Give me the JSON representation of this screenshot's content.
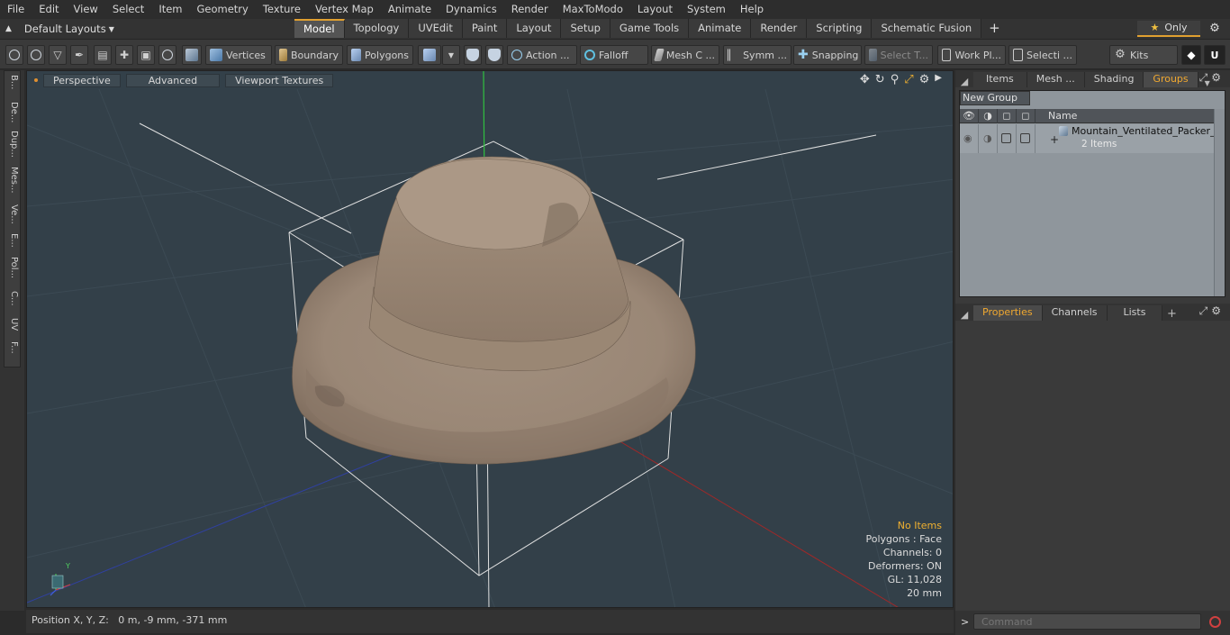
{
  "menu": [
    "File",
    "Edit",
    "View",
    "Select",
    "Item",
    "Geometry",
    "Texture",
    "Vertex Map",
    "Animate",
    "Dynamics",
    "Render",
    "MaxToModo",
    "Layout",
    "System",
    "Help"
  ],
  "layout_select": "Default Layouts",
  "tabs": [
    "Model",
    "Topology",
    "UVEdit",
    "Paint",
    "Layout",
    "Setup",
    "Game Tools",
    "Animate",
    "Render",
    "Scripting",
    "Schematic Fusion"
  ],
  "active_tab": "Model",
  "only_label": "Only",
  "toolbar": {
    "vertices": "Vertices",
    "boundary": "Boundary",
    "polygons": "Polygons",
    "action": "Action ...",
    "falloff": "Falloff",
    "mesh_c": "Mesh C ...",
    "symm": "Symm ...",
    "snapping": "Snapping",
    "select_t": "Select T...",
    "work_pl": "Work Pl...",
    "selecti": "Selecti ...",
    "kits": "Kits"
  },
  "left_tabs": [
    "B...",
    "De...",
    "Dup...",
    "Mes...",
    "Ve...",
    "E...",
    "Pol...",
    "C...",
    "UV",
    "F..."
  ],
  "viewport": {
    "perspective": "Perspective",
    "advanced": "Advanced",
    "textures": "Viewport Textures",
    "info": {
      "no_items": "No Items",
      "polygons": "Polygons : Face",
      "channels": "Channels: 0",
      "deformers": "Deformers: ON",
      "gl": "GL: 11,028",
      "scale": "20 mm"
    },
    "axis_y": "Y"
  },
  "status": "Position X, Y, Z:   0 m, -9 mm, -371 mm",
  "right_panel": {
    "top_tabs": [
      "Items",
      "Mesh ...",
      "Shading",
      "Groups"
    ],
    "active_top_tab": "Groups",
    "new_group": "New Group",
    "name_col": "Name",
    "group_name": "Mountain_Ventilated_Packer_...",
    "group_count": "2 Items",
    "bottom_tabs": [
      "Properties",
      "Channels",
      "Lists"
    ],
    "active_bottom_tab": "Properties",
    "command_placeholder": "Command"
  },
  "colors": {
    "accent": "#e0a030",
    "viewport_bg": "#334049",
    "hat": "#a08c7a"
  }
}
